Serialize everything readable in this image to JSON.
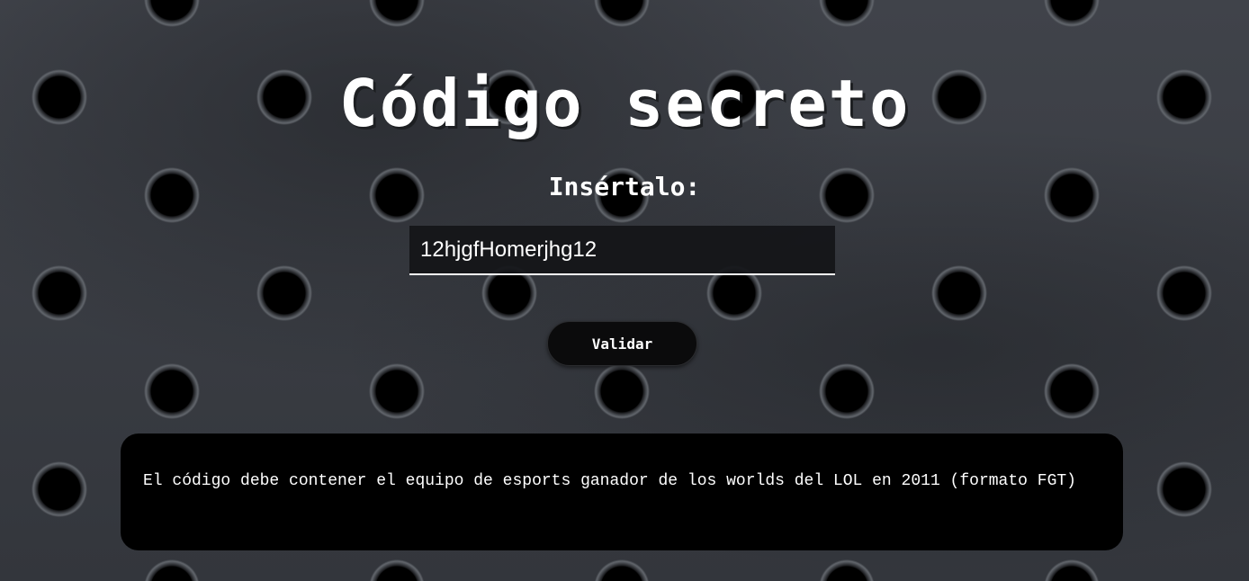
{
  "page": {
    "title": "Código secreto",
    "subtitle": "Insértalo:"
  },
  "form": {
    "code_value": "12hjgfHomerjhg12",
    "validate_label": "Validar"
  },
  "hint": {
    "text": "El código debe contener el equipo de esports ganador de los worlds del LOL en 2011 (formato FGT)"
  },
  "colors": {
    "background": "#3a3d43",
    "hole": "#000000",
    "text": "#ffffff",
    "panel": "#000000"
  }
}
